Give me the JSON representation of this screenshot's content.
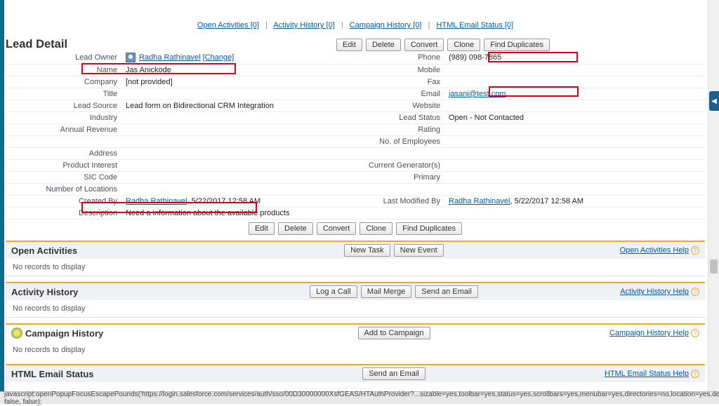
{
  "topnav": {
    "open_activities": "Open Activities [0]",
    "activity_history": "Activity History [0]",
    "campaign_history": "Campaign History [0]",
    "html_email_status": "HTML Email Status [0]",
    "sep": "|"
  },
  "header": {
    "title": "Lead Detail"
  },
  "buttons": {
    "edit": "Edit",
    "delete": "Delete",
    "convert": "Convert",
    "clone": "Clone",
    "find_duplicates": "Find Duplicates",
    "new_task": "New Task",
    "new_event": "New Event",
    "log_call": "Log a Call",
    "mail_merge": "Mail Merge",
    "send_email": "Send an Email",
    "add_campaign": "Add to Campaign"
  },
  "detail": {
    "left": {
      "lead_owner_lbl": "Lead Owner",
      "lead_owner_val": "Radha Rathinavel",
      "change": "[Change]",
      "name_lbl": "Name",
      "name_val": "Jas Anickode",
      "company_lbl": "Company",
      "company_val": "[not provided]",
      "title_lbl": "Title",
      "title_val": "",
      "lead_source_lbl": "Lead Source",
      "lead_source_val": "Lead form on Bidirectional CRM Integration",
      "industry_lbl": "Industry",
      "industry_val": "",
      "annual_revenue_lbl": "Annual Revenue",
      "annual_revenue_val": "",
      "address_lbl": "Address",
      "address_val": "",
      "product_interest_lbl": "Product Interest",
      "product_interest_val": "",
      "sic_code_lbl": "SIC Code",
      "sic_code_val": "",
      "num_locations_lbl": "Number of Locations",
      "num_locations_val": "",
      "created_by_lbl": "Created By",
      "created_by_name": "Radha Rathinavel",
      "created_by_date": ", 5/22/2017 12:58 AM",
      "description_lbl": "Description",
      "description_val": "Need a information about the available products"
    },
    "right": {
      "phone_lbl": "Phone",
      "phone_val": "(989) 098-7865",
      "mobile_lbl": "Mobile",
      "mobile_val": "",
      "fax_lbl": "Fax",
      "fax_val": "",
      "email_lbl": "Email",
      "email_val": "jasani@test.com",
      "website_lbl": "Website",
      "website_val": "",
      "lead_status_lbl": "Lead Status",
      "lead_status_val": "Open - Not Contacted",
      "rating_lbl": "Rating",
      "rating_val": "",
      "no_employees_lbl": "No. of Employees",
      "no_employees_val": "",
      "current_gen_lbl": "Current Generator(s)",
      "current_gen_val": "",
      "primary_lbl": "Primary",
      "primary_val": "",
      "last_mod_lbl": "Last Modified By",
      "last_mod_name": "Radha Rathinavel",
      "last_mod_date": ", 5/22/2017 12:58 AM"
    }
  },
  "related": {
    "open_activities": {
      "title": "Open Activities",
      "help": "Open Activities Help",
      "empty": "No records to display"
    },
    "activity_history": {
      "title": "Activity History",
      "help": "Activity History Help",
      "empty": "No records to display"
    },
    "campaign_history": {
      "title": "Campaign History",
      "help": "Campaign History Help",
      "empty": "No records to display"
    },
    "html_email": {
      "title": "HTML Email Status",
      "help": "HTML Email Status Help"
    }
  },
  "statusbar": "javascript:openPopupFocusEscapePounds('https://login.salesforce.com/services/auth/sso/00D30000000XsfGEAS/HTAuthProvider?...sizable=yes,toolbar=yes,status=yes,scrollbars=yes,menubar=yes,directories=no,location=yes,dependant=no', false, false);",
  "side_arrow": "◀"
}
